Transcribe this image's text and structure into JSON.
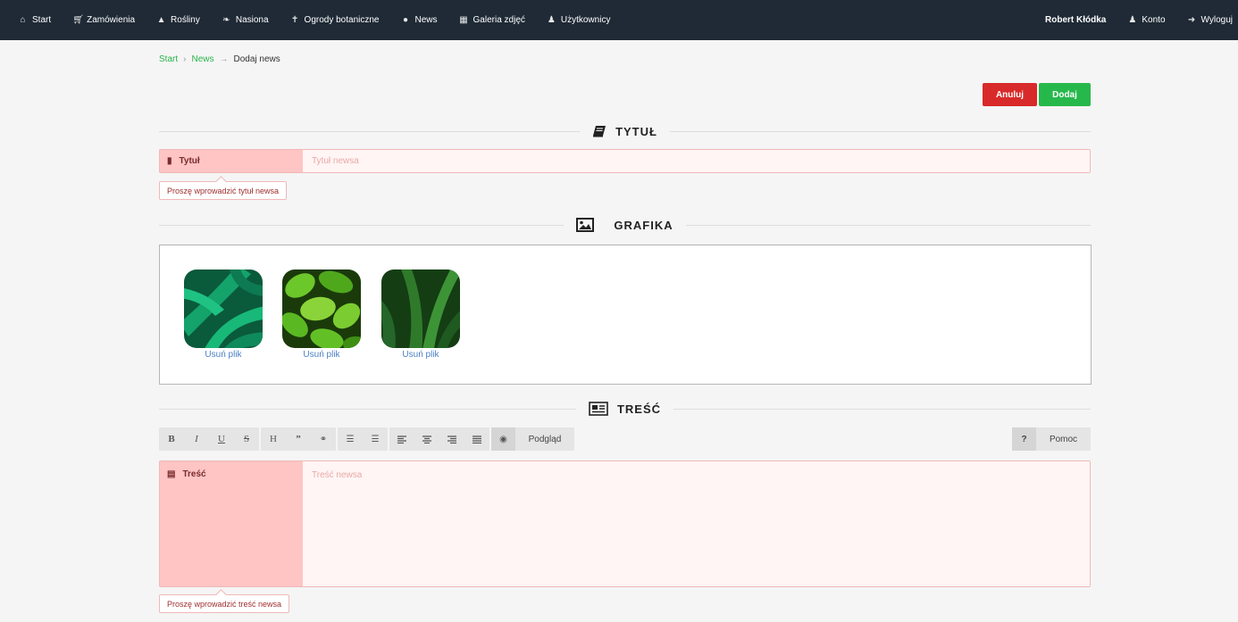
{
  "nav": {
    "items": [
      {
        "label": "Start",
        "icon": "home-icon"
      },
      {
        "label": "Zamówienia",
        "icon": "cart-icon"
      },
      {
        "label": "Rośliny",
        "icon": "plant-icon"
      },
      {
        "label": "Nasiona",
        "icon": "leaf-icon"
      },
      {
        "label": "Ogrody botaniczne",
        "icon": "signpost-icon"
      },
      {
        "label": "News",
        "icon": "globe-icon"
      },
      {
        "label": "Galeria zdjęć",
        "icon": "picture-icon"
      },
      {
        "label": "Użytkownicy",
        "icon": "users-icon"
      }
    ],
    "user_name": "Robert Kłódka",
    "account_label": "Konto",
    "logout_label": "Wyloguj"
  },
  "breadcrumb": {
    "items": [
      "Start",
      "News"
    ],
    "current": "Dodaj news"
  },
  "actions": {
    "cancel_label": "Anuluj",
    "add_label": "Dodaj"
  },
  "colors": {
    "navbar": "#1f2a36",
    "cancel": "#d82a2a",
    "add": "#27b84c",
    "link": "#28b44a",
    "error_bg": "#ffc4c4"
  },
  "title_section": {
    "heading": "TYTUŁ",
    "label": "Tytuł",
    "placeholder": "Tytuł newsa",
    "value": "",
    "error": "Proszę wprowadzić tytuł newsa"
  },
  "image_section": {
    "heading": "GRAFIKA",
    "files": [
      {
        "remove_label": "Usuń plik"
      },
      {
        "remove_label": "Usuń plik"
      },
      {
        "remove_label": "Usuń plik"
      }
    ]
  },
  "content_section": {
    "heading": "TREŚĆ",
    "label": "Treść",
    "placeholder": "Treść newsa",
    "value": "",
    "error": "Proszę wprowadzić treść newsa",
    "toolbar": {
      "bold": "B",
      "italic": "I",
      "underline": "U",
      "strike": "S",
      "heading": "H",
      "quote": "”",
      "link": "⚭",
      "ordered_list": "☰",
      "unordered_list": "☰",
      "preview_label": "Podgląd",
      "help_icon": "?",
      "help_label": "Pomoc"
    }
  }
}
